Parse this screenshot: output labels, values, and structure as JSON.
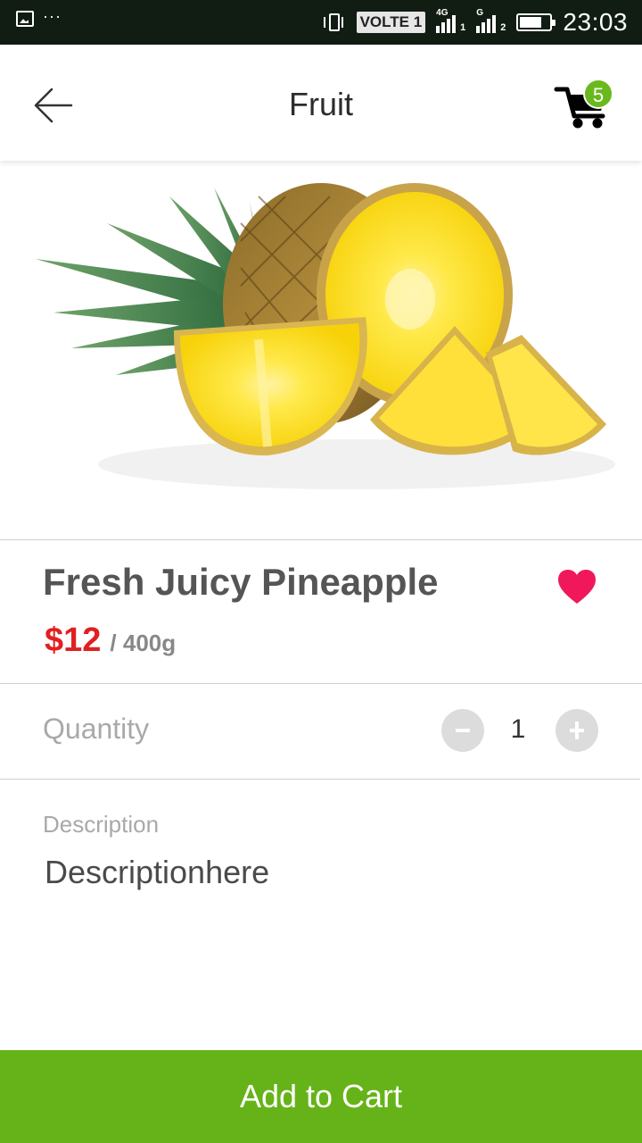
{
  "status_bar": {
    "volte": "VOLTE 1",
    "network_1": "4G",
    "network_2": "G",
    "sim_1": "1",
    "sim_2": "2",
    "time": "23:03",
    "battery_level": 0.75
  },
  "header": {
    "title": "Fruit",
    "cart_count": "5"
  },
  "product": {
    "name": "Fresh Juicy Pineapple",
    "price": "$12",
    "unit": "/ 400g",
    "favorited": true
  },
  "quantity": {
    "label": "Quantity",
    "value": "1"
  },
  "description": {
    "label": "Description",
    "text": "Descriptionhere"
  },
  "actions": {
    "add_to_cart": "Add to Cart"
  },
  "colors": {
    "accent_green": "#66b319",
    "badge_green": "#6ab91c",
    "price_red": "#e02020",
    "heart_pink": "#f0185a",
    "status_bar_bg": "#111d13"
  },
  "icons": [
    "image-icon",
    "vibrate-icon",
    "signal-icon",
    "battery-icon",
    "back-arrow-icon",
    "cart-icon",
    "heart-icon",
    "minus-icon",
    "plus-icon"
  ]
}
